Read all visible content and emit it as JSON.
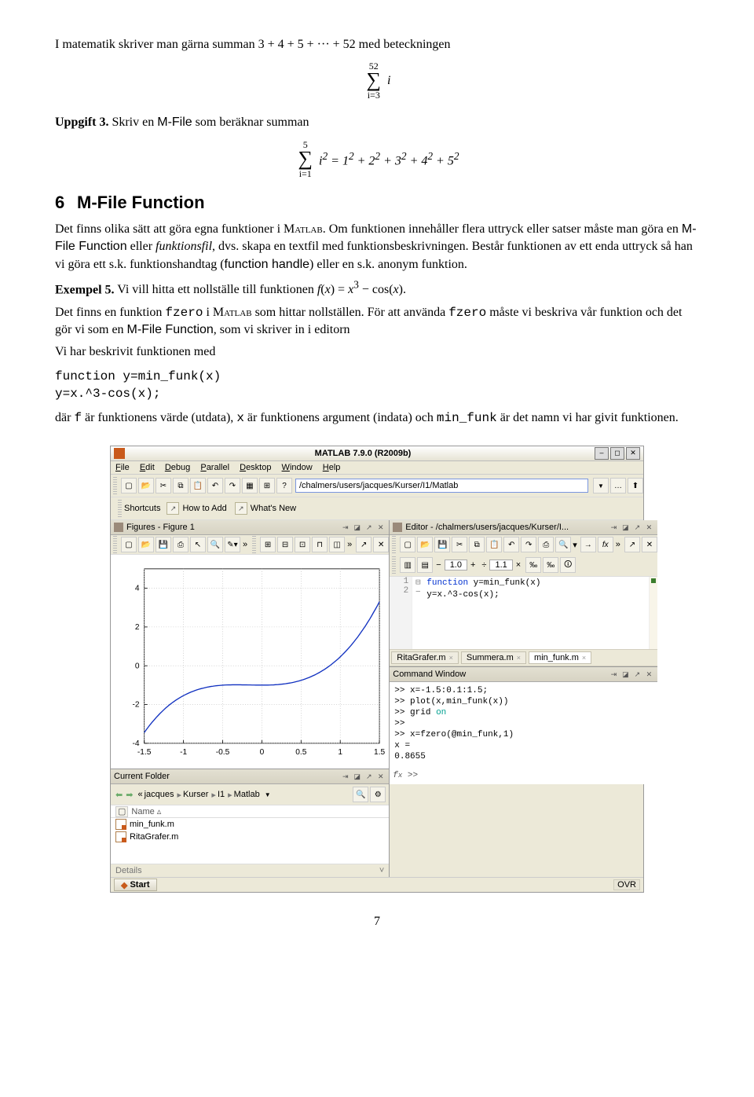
{
  "para1_a": "I matematik skriver man gärna summan 3 + 4 + 5 + ··· + 52 med beteckningen",
  "sum1": {
    "up": "52",
    "sig": "∑",
    "lo": "i=3",
    "body": "i"
  },
  "para2": {
    "label": "Uppgift 3.",
    "text": " Skriv en ",
    "mf": "M-File",
    "text2": " som beräknar summan"
  },
  "sum2": {
    "up": "5",
    "sig": "∑",
    "lo": "i=1",
    "body_html": "i² = 1² + 2² + 3² + 4² + 5²"
  },
  "section": {
    "num": "6",
    "title": "M-File Function"
  },
  "para3": {
    "a": "Det finns olika sätt att göra egna funktioner i ",
    "matlab": "Matlab",
    "b": ". Om funktionen innehåller flera uttryck eller satser måste man göra en ",
    "mf": "M-File Function",
    "c": " eller ",
    "it": "funktionsfil",
    "d": ", dvs. skapa en textfil med funktionsbeskrivningen. Består funktionen av ett enda uttryck så han vi göra ett s.k. funktionshandtag (",
    "fh": "function handle",
    "e": ") eller en s.k. anonym funktion."
  },
  "para4": {
    "label": "Exempel 5.",
    "text": " Vi vill hitta ett nollställe till funktionen f(x) = x³ − cos(x)."
  },
  "para5": {
    "a": "Det finns en funktion ",
    "fz1": "fzero",
    "b": " i ",
    "matlab": "Matlab",
    "c": " som hittar nollställen. För att använda ",
    "fz2": "fzero",
    "d": " måste vi beskriva vår funktion och det gör vi som en ",
    "mf": "M-File Function",
    "e": ", som vi skriver in i editorn"
  },
  "para6": "Vi har beskrivit funktionen med",
  "code": {
    "l1": "function y=min_funk(x)",
    "l2": "y=x.^3-cos(x);"
  },
  "para7": {
    "a": "där ",
    "f": "f",
    "b": " är funktionens värde (utdata), ",
    "x": "x",
    "c": " är funktionens argument (indata) och ",
    "mf": "min_funk",
    "d": " är det namn vi har givit funktionen."
  },
  "screenshot": {
    "title": "MATLAB 7.9.0 (R2009b)",
    "menus": [
      "File",
      "Edit",
      "Debug",
      "Parallel",
      "Desktop",
      "Window",
      "Help"
    ],
    "path": "/chalmers/users/jacques/Kurser/I1/Matlab",
    "shortcuts": {
      "label": "Shortcuts",
      "items": [
        "How to Add",
        "What's New"
      ]
    },
    "figures": {
      "title": "Figures - Figure 1"
    },
    "current_folder": {
      "title": "Current Folder",
      "crumbs": [
        "jacques",
        "Kurser",
        "I1",
        "Matlab"
      ],
      "header": "Name ▵",
      "files": [
        "min_funk.m",
        "RitaGrafer.m"
      ],
      "details": "Details"
    },
    "editor": {
      "title": "Editor - /chalmers/users/jacques/Kurser/I...",
      "scale1": "1.0",
      "scale2": "1.1",
      "lines": [
        {
          "n": "1",
          "fold": "⊟",
          "kw": "function",
          "rest": " y=min_funk(x)"
        },
        {
          "n": "2",
          "fold": "−",
          "kw": "",
          "rest": "y=x.^3-cos(x);"
        }
      ],
      "tabs": [
        {
          "name": "RitaGrafer.m",
          "active": false
        },
        {
          "name": "Summera.m",
          "active": false
        },
        {
          "name": "min_funk.m",
          "active": true
        }
      ]
    },
    "command": {
      "title": "Command Window",
      "lines": [
        ">> x=-1.5:0.1:1.5;",
        ">> plot(x,min_funk(x))",
        {
          "a": ">> grid ",
          "kw": "on"
        },
        ">>",
        ">> x=fzero(@min_funk,1)",
        "x =",
        "    0.8655"
      ]
    },
    "status": {
      "start": "Start",
      "ovr": "OVR"
    }
  },
  "chart_data": {
    "type": "line",
    "x": [
      -1.5,
      -1.0,
      -0.5,
      0.0,
      0.5,
      1.0,
      1.5
    ],
    "y": [
      -3.45,
      -1.54,
      -1.0,
      -1.0,
      -0.75,
      0.46,
      3.3
    ],
    "xticks": [
      -1.5,
      -1.0,
      -0.5,
      0.0,
      0.5,
      1.0,
      1.5
    ],
    "yticks": [
      -4,
      -2,
      0,
      2,
      4
    ],
    "xlim": [
      -1.5,
      1.5
    ],
    "ylim": [
      -4,
      5
    ],
    "title": "",
    "xlabel": "",
    "ylabel": "",
    "legend": null,
    "grid": true
  },
  "pagenum": "7"
}
